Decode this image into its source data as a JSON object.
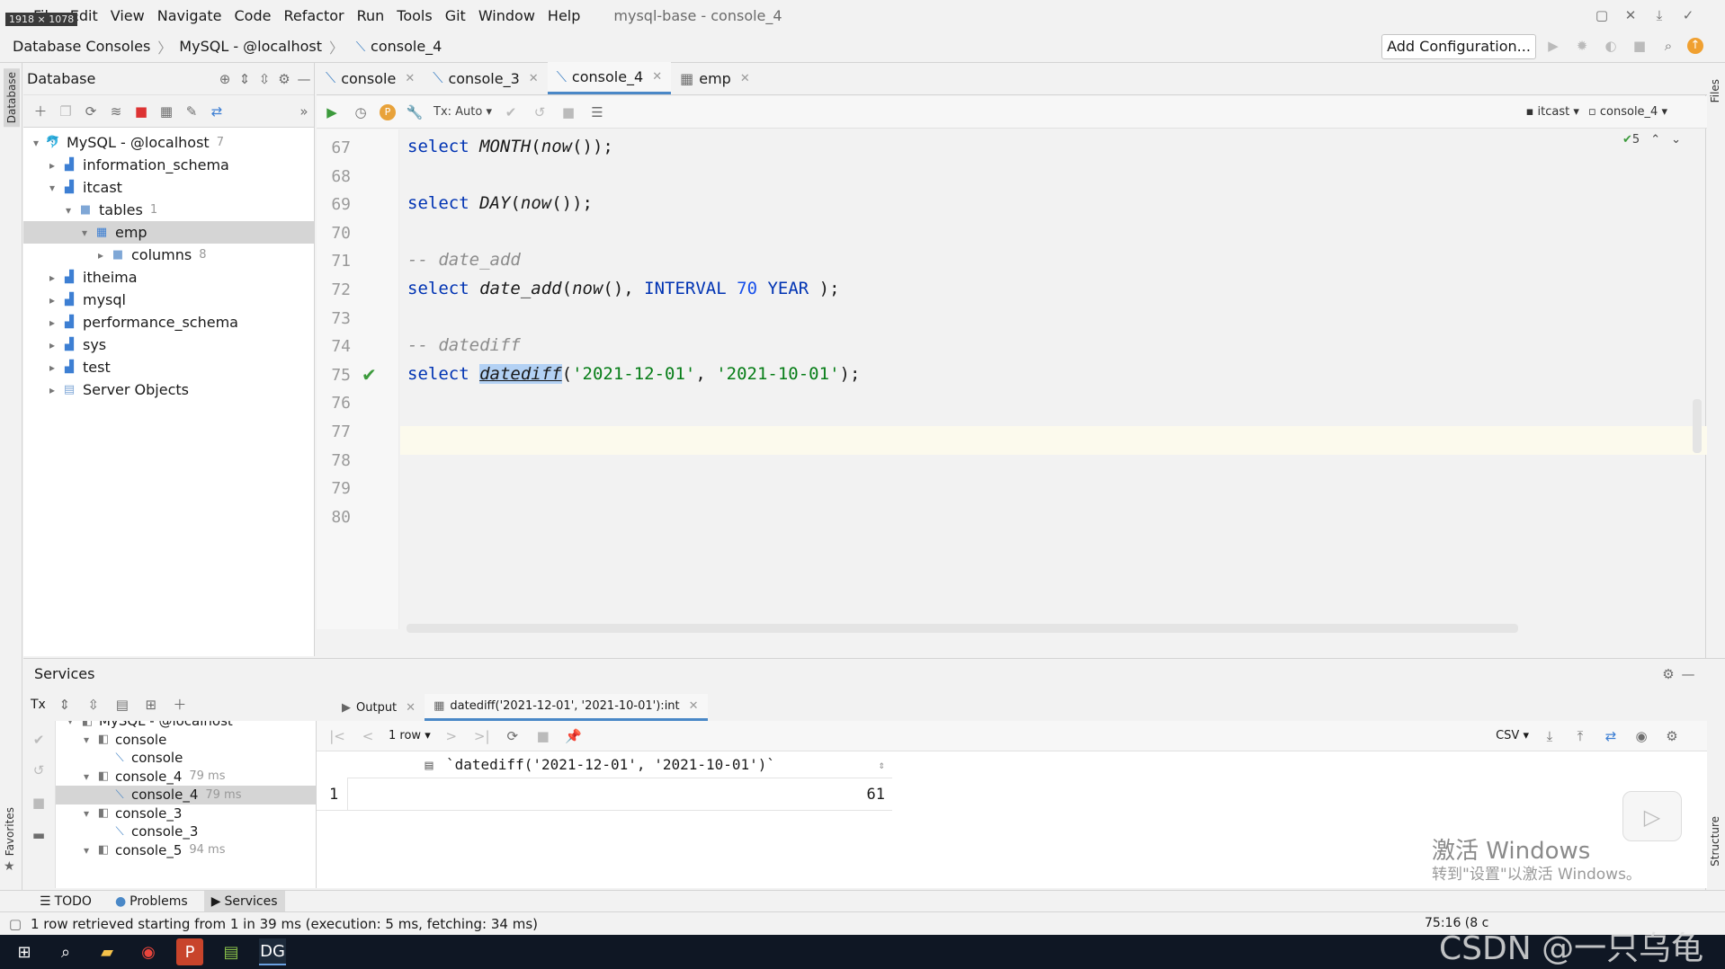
{
  "size_badge": "1918 × 1078",
  "menu": [
    "File",
    "Edit",
    "View",
    "Navigate",
    "Code",
    "Refactor",
    "Run",
    "Tools",
    "Git",
    "Window",
    "Help"
  ],
  "window_title": "mysql-base - console_4",
  "breadcrumb": [
    "Database Consoles",
    "MySQL - @localhost",
    "console_4"
  ],
  "add_configuration": "Add Configuration...",
  "left_strip": {
    "database": "Database",
    "favorites": "Favorites"
  },
  "right_strip": {
    "files": "Files",
    "structure": "Structure"
  },
  "db_panel": {
    "title": "Database",
    "tree": [
      {
        "label": "MySQL - @localhost",
        "count": "7",
        "level": 0,
        "arrow": "▾",
        "icon": "datasource-icon"
      },
      {
        "label": "information_schema",
        "level": 1,
        "arrow": "▸",
        "icon": "schema-icon"
      },
      {
        "label": "itcast",
        "level": 1,
        "arrow": "▾",
        "icon": "schema-icon"
      },
      {
        "label": "tables",
        "count": "1",
        "level": 2,
        "arrow": "▾",
        "icon": "folder-icon"
      },
      {
        "label": "emp",
        "level": 3,
        "arrow": "▾",
        "icon": "table-icon",
        "selected": true
      },
      {
        "label": "columns",
        "count": "8",
        "level": 4,
        "arrow": "▸",
        "icon": "folder-icon"
      },
      {
        "label": "itheima",
        "level": 1,
        "arrow": "▸",
        "icon": "schema-icon"
      },
      {
        "label": "mysql",
        "level": 1,
        "arrow": "▸",
        "icon": "schema-icon"
      },
      {
        "label": "performance_schema",
        "level": 1,
        "arrow": "▸",
        "icon": "schema-icon"
      },
      {
        "label": "sys",
        "level": 1,
        "arrow": "▸",
        "icon": "schema-icon"
      },
      {
        "label": "test",
        "level": 1,
        "arrow": "▸",
        "icon": "schema-icon"
      },
      {
        "label": "Server Objects",
        "level": 1,
        "arrow": "▸",
        "icon": "server-objects-icon"
      }
    ]
  },
  "editor_tabs": [
    {
      "label": "console",
      "active": false
    },
    {
      "label": "console_3",
      "active": false
    },
    {
      "label": "console_4",
      "active": true
    },
    {
      "label": "emp",
      "active": false
    }
  ],
  "editor_toolbar": {
    "tx": "Tx: Auto",
    "schema": "itcast",
    "session": "console_4",
    "inspections": "5"
  },
  "code_lines": [
    {
      "n": "67",
      "html": "<span class='kw'>select</span> <span class='fn'>MONTH</span>(<span class='fn'>now</span>());"
    },
    {
      "n": "68",
      "html": ""
    },
    {
      "n": "69",
      "html": "<span class='kw'>select</span> <span class='fn'>DAY</span>(<span class='fn'>now</span>());"
    },
    {
      "n": "70",
      "html": ""
    },
    {
      "n": "71",
      "html": "<span class='cm'>-- date_add</span>"
    },
    {
      "n": "72",
      "html": "<span class='kw'>select</span> <span class='fn'>date_add</span>(<span class='fn'>now</span>(), <span class='kw'>INTERVAL</span> <span class='num'>70</span> <span class='kw'>YEAR</span> );"
    },
    {
      "n": "73",
      "html": ""
    },
    {
      "n": "74",
      "html": "<span class='cm'>-- datediff</span>"
    },
    {
      "n": "75",
      "html": "<span class='kw'>select</span> <span class='hl'>datediff</span>(<span class='str'>'2021-12-01'</span>, <span class='str'>'2021-10-01'</span>);",
      "current": true
    },
    {
      "n": "76",
      "html": ""
    },
    {
      "n": "77",
      "html": ""
    },
    {
      "n": "78",
      "html": ""
    },
    {
      "n": "79",
      "html": ""
    },
    {
      "n": "80",
      "html": ""
    }
  ],
  "services": {
    "title": "Services",
    "tx": "Tx",
    "tree": [
      {
        "label": "MySQL - @localhost",
        "level": 0,
        "arrow": "▾"
      },
      {
        "label": "console",
        "level": 1,
        "arrow": "▾"
      },
      {
        "label": "console",
        "level": 2,
        "arrow": ""
      },
      {
        "label": "console_4",
        "time": "79 ms",
        "level": 1,
        "arrow": "▾"
      },
      {
        "label": "console_4",
        "time": "79 ms",
        "level": 2,
        "arrow": "",
        "selected": true
      },
      {
        "label": "console_3",
        "level": 1,
        "arrow": "▾"
      },
      {
        "label": "console_3",
        "level": 2,
        "arrow": ""
      },
      {
        "label": "console_5",
        "time": "94 ms",
        "level": 1,
        "arrow": "▾"
      }
    ]
  },
  "result_tabs": [
    {
      "label": "Output",
      "active": false
    },
    {
      "label": "datediff('2021-12-01', '2021-10-01'):int",
      "active": true
    }
  ],
  "result_nav": {
    "rows": "1 row",
    "export": "CSV"
  },
  "result_grid": {
    "column": "`datediff('2021-12-01', '2021-10-01')`",
    "rows": [
      {
        "n": "1",
        "value": "61"
      }
    ]
  },
  "bottom_tabs": [
    "TODO",
    "Problems",
    "Services"
  ],
  "status_text": "1 row retrieved starting from 1 in 39 ms (execution: 5 ms, fetching: 34 ms)",
  "status_position": "75:16 (8 c",
  "watermark": {
    "line1": "激活 Windows",
    "line2": "转到\"设置\"以激活 Windows。"
  },
  "csdn": "CSDN @一只乌龟"
}
